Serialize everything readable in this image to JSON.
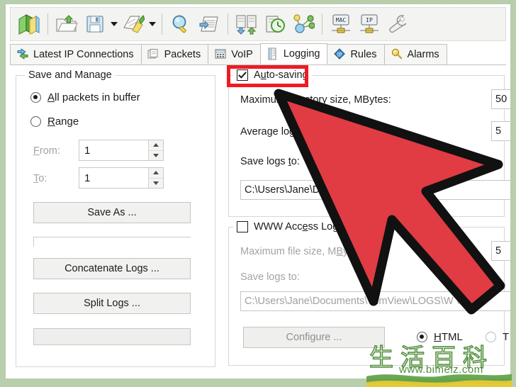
{
  "window": {
    "bg_outer": "#b8ceac",
    "bg_app": "#ffffff"
  },
  "toolbar": {
    "items": [
      {
        "name": "open-capture-icon",
        "title": "Open Capture"
      },
      {
        "name": "sep1",
        "title": "separator"
      },
      {
        "name": "open-folder-icon",
        "title": "Load"
      },
      {
        "name": "save-icon",
        "title": "Save"
      },
      {
        "name": "save-dropdown-arrow",
        "title": "Save options"
      },
      {
        "name": "clear-brush-icon",
        "title": "Clear"
      },
      {
        "name": "clear-dropdown-arrow",
        "title": "Clear options"
      },
      {
        "name": "sep2",
        "title": "separator"
      },
      {
        "name": "find-icon",
        "title": "Find"
      },
      {
        "name": "report-icon",
        "title": "Report"
      },
      {
        "name": "sep3",
        "title": "separator"
      },
      {
        "name": "exchange-icon",
        "title": "Exchange"
      },
      {
        "name": "history-icon",
        "title": "History"
      },
      {
        "name": "network-nodes-icon",
        "title": "Nodes"
      },
      {
        "name": "sep4",
        "title": "separator"
      },
      {
        "name": "mac-icon",
        "title": "MAC"
      },
      {
        "name": "ip-icon",
        "title": "IP"
      },
      {
        "name": "settings-wrench-icon",
        "title": "Settings"
      }
    ]
  },
  "tabs": [
    {
      "label": "Latest IP Connections",
      "icon": "arrows-icon",
      "active": false
    },
    {
      "label": "Packets",
      "icon": "packets-icon",
      "active": false
    },
    {
      "label": "VoIP",
      "icon": "voip-icon",
      "active": false
    },
    {
      "label": "Logging",
      "icon": "logging-icon",
      "active": true
    },
    {
      "label": "Rules",
      "icon": "rules-icon",
      "active": false
    },
    {
      "label": "Alarms",
      "icon": "alarms-icon",
      "active": false
    }
  ],
  "save_and_manage": {
    "title": "Save and Manage",
    "radio_all": {
      "label": "All packets in buffer",
      "selected": true
    },
    "radio_range": {
      "label": "Range",
      "selected": false
    },
    "from_label": "From:",
    "from_value": "1",
    "to_label": "To:",
    "to_value": "1",
    "save_as_button": "Save As ...",
    "concatenate_button": "Concatenate Logs ...",
    "split_button": "Split Logs ..."
  },
  "auto_saving": {
    "checkbox_label": "Auto-saving",
    "checked": true,
    "max_dir_label": "Maximum directory size, MBytes:",
    "max_dir_value": "50",
    "average_log_label": "Average log",
    "average_log_value": "5",
    "save_logs_label": "Save logs to:",
    "save_logs_path": "C:\\Users\\Jane\\Do"
  },
  "www_access_logging": {
    "checkbox_label": "WWW Access Logg",
    "checked": false,
    "max_file_label": "Maximum file size, MBy",
    "max_file_value": "5",
    "save_logs_label": "Save logs to:",
    "save_logs_path": "C:\\Users\\Jane\\Documents\\      mmView\\LOGS\\W    \\Log",
    "configure_button": "Configure ...",
    "format_html": {
      "label": "HTML",
      "selected": true
    },
    "format_txt": {
      "label": "T",
      "selected": false
    }
  },
  "annotation": {
    "highlight_color": "#ee1b22",
    "arrow_fill": "#e13b44",
    "arrow_stroke": "#111111"
  },
  "watermark": {
    "cjk": "生活百科",
    "url": "www.bimeiz.com",
    "color": "#55913f"
  }
}
